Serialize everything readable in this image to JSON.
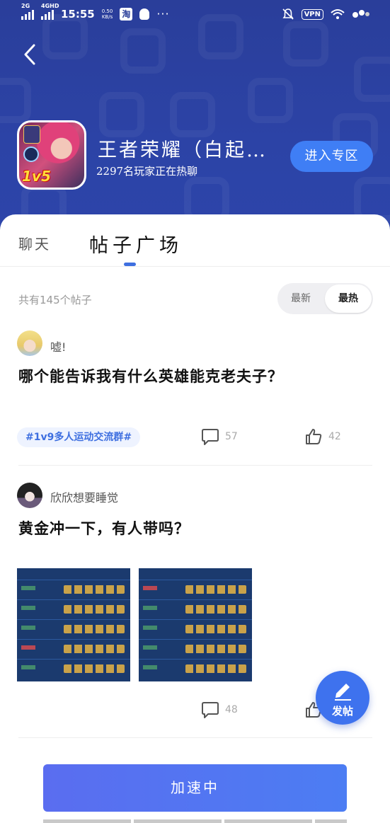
{
  "status_bar": {
    "signal1": "2G",
    "signal2": "4GHD",
    "time": "15:55",
    "speed_value": "0.50",
    "speed_unit": "KB/s",
    "app_icon": "淘",
    "vpn": "VPN"
  },
  "header": {
    "game_title": "王者荣耀（白起…",
    "players_online": "2297名玩家正在热聊",
    "enter_button": "进入专区",
    "badge": "1v5"
  },
  "tabs": [
    {
      "label": "聊天",
      "active": false
    },
    {
      "label": "帖子广场",
      "active": true
    }
  ],
  "list_header": {
    "count_text": "共有145个帖子",
    "sort_options": [
      "最新",
      "最热"
    ],
    "selected_sort": "最热"
  },
  "posts": [
    {
      "user": "嘘!",
      "title": "哪个能告诉我有什么英雄能克老夫子？",
      "tag": "#1v9多人运动交流群#",
      "comments": "57",
      "likes": "42"
    },
    {
      "user": "欣欣想要睡觉",
      "title": "黄金冲一下，有人带吗？",
      "comments": "48",
      "image_count": 2
    }
  ],
  "fab": {
    "label": "发帖"
  },
  "bottom_button": {
    "label": "加速中"
  },
  "colors": {
    "header_bg": "#2c43a6",
    "accent": "#3e6fe0",
    "enter_button_bg": "#3f7ef5"
  }
}
